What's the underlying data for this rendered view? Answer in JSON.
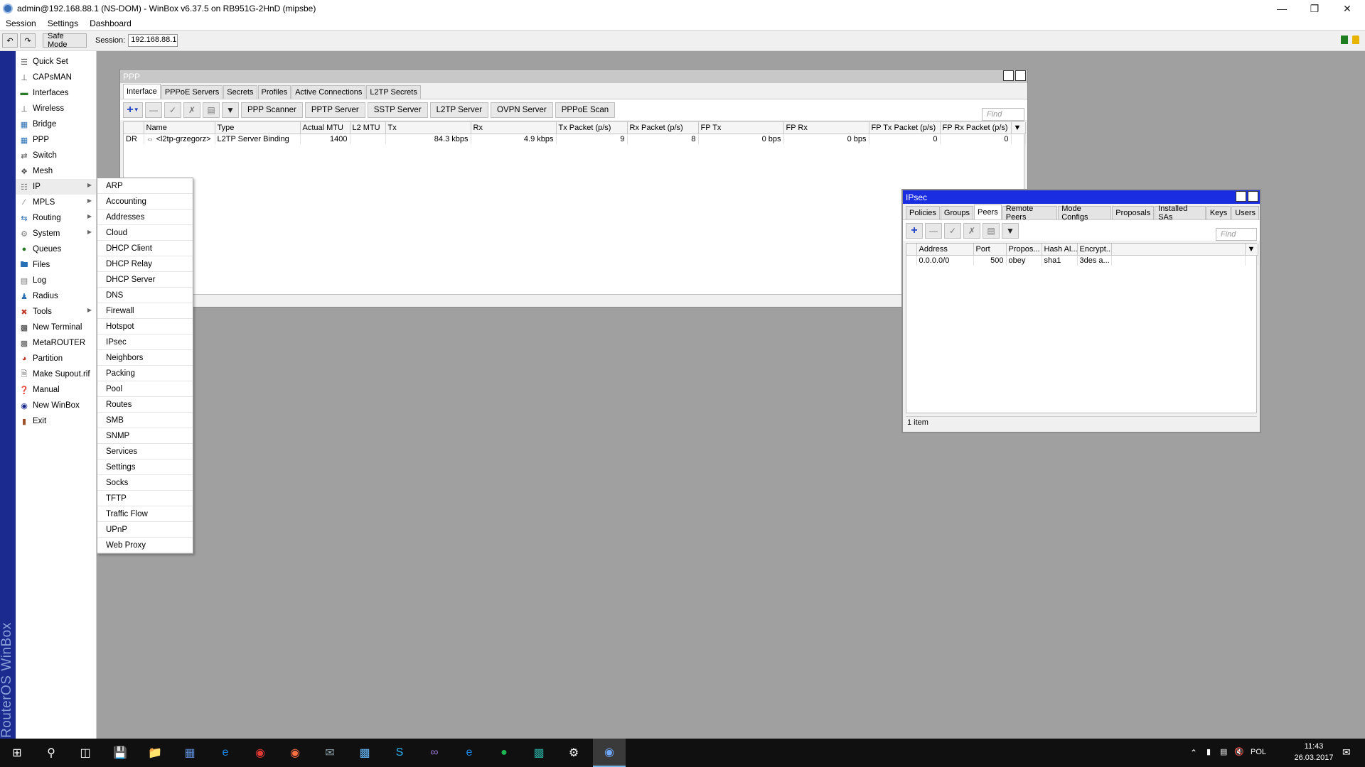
{
  "window": {
    "title": "admin@192.168.88.1 (NS-DOM) - WinBox v6.37.5 on RB951G-2HnD (mipsbe)"
  },
  "menubar": [
    "Session",
    "Settings",
    "Dashboard"
  ],
  "toolbar": {
    "safe_mode": "Safe Mode",
    "session_label": "Session:",
    "session_value": "192.168.88.1"
  },
  "brand": "RouterOS WinBox",
  "leftnav": [
    {
      "label": "Quick Set",
      "icon": "quick-set-icon"
    },
    {
      "label": "CAPsMAN",
      "icon": "capsman-icon"
    },
    {
      "label": "Interfaces",
      "icon": "interfaces-icon"
    },
    {
      "label": "Wireless",
      "icon": "wireless-icon"
    },
    {
      "label": "Bridge",
      "icon": "bridge-icon"
    },
    {
      "label": "PPP",
      "icon": "ppp-icon"
    },
    {
      "label": "Switch",
      "icon": "switch-icon"
    },
    {
      "label": "Mesh",
      "icon": "mesh-icon"
    },
    {
      "label": "IP",
      "icon": "ip-icon",
      "submenu": true
    },
    {
      "label": "MPLS",
      "icon": "mpls-icon",
      "submenu": true
    },
    {
      "label": "Routing",
      "icon": "routing-icon",
      "submenu": true
    },
    {
      "label": "System",
      "icon": "system-icon",
      "submenu": true
    },
    {
      "label": "Queues",
      "icon": "queues-icon"
    },
    {
      "label": "Files",
      "icon": "files-icon"
    },
    {
      "label": "Log",
      "icon": "log-icon"
    },
    {
      "label": "Radius",
      "icon": "radius-icon"
    },
    {
      "label": "Tools",
      "icon": "tools-icon",
      "submenu": true
    },
    {
      "label": "New Terminal",
      "icon": "terminal-icon"
    },
    {
      "label": "MetaROUTER",
      "icon": "metarouter-icon"
    },
    {
      "label": "Partition",
      "icon": "partition-icon"
    },
    {
      "label": "Make Supout.rif",
      "icon": "supout-icon"
    },
    {
      "label": "Manual",
      "icon": "manual-icon"
    },
    {
      "label": "New WinBox",
      "icon": "winbox-icon"
    },
    {
      "label": "Exit",
      "icon": "exit-icon"
    }
  ],
  "ip_submenu": [
    "ARP",
    "Accounting",
    "Addresses",
    "Cloud",
    "DHCP Client",
    "DHCP Relay",
    "DHCP Server",
    "DNS",
    "Firewall",
    "Hotspot",
    "IPsec",
    "Neighbors",
    "Packing",
    "Pool",
    "Routes",
    "SMB",
    "SNMP",
    "Services",
    "Settings",
    "Socks",
    "TFTP",
    "Traffic Flow",
    "UPnP",
    "Web Proxy"
  ],
  "ppp": {
    "title": "PPP",
    "tabs": [
      "Interface",
      "PPPoE Servers",
      "Secrets",
      "Profiles",
      "Active Connections",
      "L2TP Secrets"
    ],
    "selected_tab": "Interface",
    "buttons": [
      "PPP Scanner",
      "PPTP Server",
      "SSTP Server",
      "L2TP Server",
      "OVPN Server",
      "PPPoE Scan"
    ],
    "find_placeholder": "Find",
    "columns": [
      "Name",
      "Type",
      "Actual MTU",
      "L2 MTU",
      "Tx",
      "Rx",
      "Tx Packet (p/s)",
      "Rx Packet (p/s)",
      "FP Tx",
      "FP Rx",
      "FP Tx Packet (p/s)",
      "FP Rx Packet (p/s)"
    ],
    "rows": [
      {
        "flag": "DR",
        "name": "<l2tp-grzegorz>",
        "type": "L2TP Server Binding",
        "actual_mtu": "1400",
        "l2_mtu": "",
        "tx": "84.3 kbps",
        "rx": "4.9 kbps",
        "tx_pps": "9",
        "rx_pps": "8",
        "fp_tx": "0 bps",
        "fp_rx": "0 bps",
        "fp_tx_pps": "0",
        "fp_rx_pps": "0"
      }
    ]
  },
  "ipsec": {
    "title": "IPsec",
    "tabs": [
      "Policies",
      "Groups",
      "Peers",
      "Remote Peers",
      "Mode Configs",
      "Proposals",
      "Installed SAs",
      "Keys",
      "Users"
    ],
    "selected_tab": "Peers",
    "find_placeholder": "Find",
    "columns": [
      "Address",
      "Port",
      "Propos...",
      "Hash Al...",
      "Encrypt..."
    ],
    "rows": [
      {
        "address": "0.0.0.0/0",
        "port": "500",
        "proposal": "obey",
        "hash": "sha1",
        "encrypt": "3des a..."
      }
    ],
    "status": "1 item"
  },
  "taskbar": {
    "lang": "POL",
    "time": "11:43",
    "date": "26.03.2017"
  },
  "colors": {
    "brand_strip": "#1b2a8f",
    "add_button": "#1d3fbf",
    "status_green": "#1e7d1e",
    "status_lock": "#e8b400"
  }
}
